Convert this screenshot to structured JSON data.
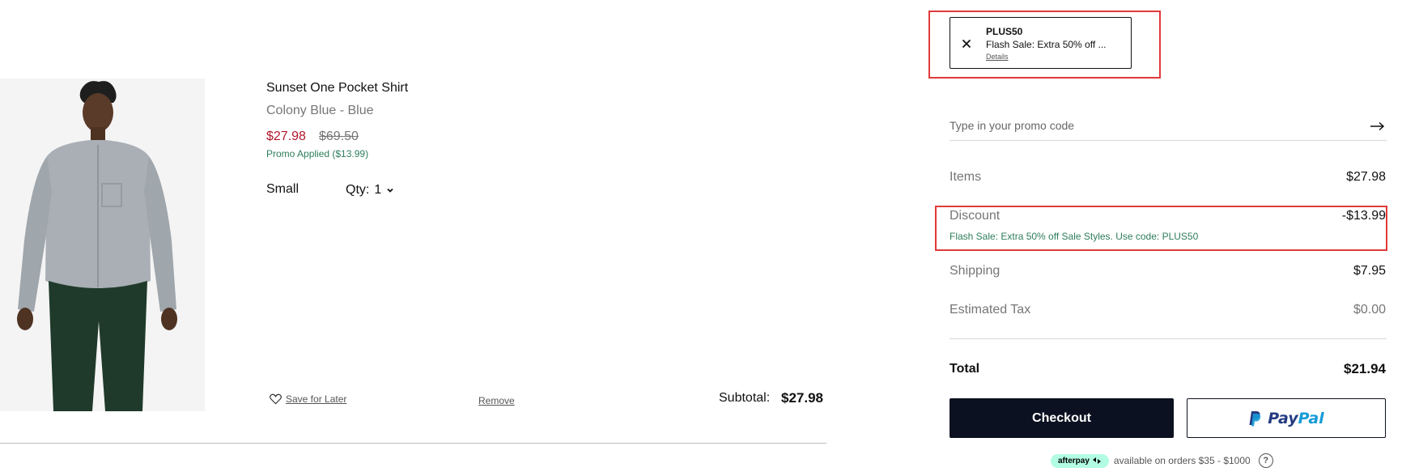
{
  "product": {
    "image_icon": "product-photo-model-in-shirt",
    "name": "Sunset One Pocket Shirt",
    "color": "Colony Blue - Blue",
    "sale_price": "$27.98",
    "original_price": "$69.50",
    "promo_applied": "Promo Applied ($13.99)",
    "size": "Small",
    "qty_label": "Qty:",
    "qty_value": "1",
    "save_for_later": "Save for Later",
    "remove": "Remove",
    "subtotal_label": "Subtotal:",
    "subtotal_value": "$27.98"
  },
  "promo": {
    "code": "PLUS50",
    "description": "Flash Sale: Extra 50% off ...",
    "details": "Details",
    "input_placeholder": "Type in your promo code",
    "input_value": ""
  },
  "summary": {
    "items_label": "Items",
    "items_value": "$27.98",
    "discount_label": "Discount",
    "discount_value": "-$13.99",
    "discount_note": "Flash Sale: Extra 50% off Sale Styles. Use code: PLUS50",
    "shipping_label": "Shipping",
    "shipping_value": "$7.95",
    "tax_label": "Estimated Tax",
    "tax_value": "$0.00",
    "total_label": "Total",
    "total_value": "$21.94"
  },
  "buttons": {
    "checkout": "Checkout",
    "paypal_pay": "Pay",
    "paypal_pal": "Pal"
  },
  "afterpay": {
    "badge": "afterpay",
    "text": "available on orders $35 - $1000",
    "help": "?"
  },
  "colors": {
    "sale_red": "#b0182d",
    "promo_green": "#2e7d5b",
    "checkout_navy": "#0b1120",
    "highlight_red": "#e03a3a",
    "afterpay_mint": "#b2fce4",
    "paypal_dark_blue": "#253b80",
    "paypal_light_blue": "#179bd7"
  }
}
